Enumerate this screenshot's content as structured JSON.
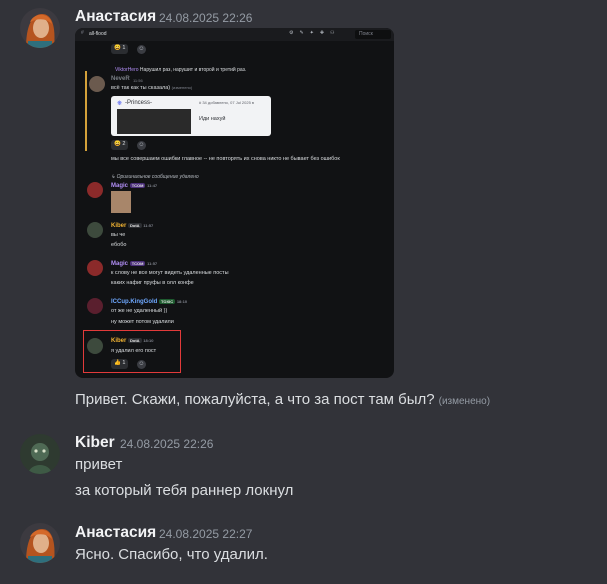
{
  "messages": [
    {
      "author": "Анастасия",
      "timestamp": "24.08.2025 22:26",
      "text": "Привет. Скажи, пожалуйста, а что за пост там был?",
      "edited_label": "(изменено)"
    },
    {
      "author": "Kiber",
      "timestamp": "24.08.2025 22:26",
      "lines": [
        "привет",
        "за который тебя раннер локнул"
      ]
    },
    {
      "author": "Анастасия",
      "timestamp": "24.08.2025 22:27",
      "text": "Ясно. Спасибо, что удалил."
    }
  ],
  "screenshot": {
    "channel": "all-flood",
    "search_placeholder": "Поиск",
    "react1_count": "1",
    "reply_preview_author": "ViktorHero",
    "reply_preview_text": "Нарушил раз, нарушит и второй и третий раз.",
    "m1_author": "NeveR",
    "m1_time": "11:56",
    "m1_text": "всё так как ты сказала)",
    "m1_edited": "(изменено)",
    "invite_title": "-Princess-",
    "invite_meta": "# 34 добавлено, 07 Jul 2025 в",
    "invite_action": "Иди нахуй",
    "react2_count": "2",
    "m2_text": "мы все совершаем ошибки  главное -- не повторять их снова никто не бывает без ошибок",
    "deleted_note": "Оригинальное сообщение удалено",
    "magic_author": "Magic",
    "magic_tag": "TCOM",
    "magic_time1": "11:47",
    "kiber_author": "Kiber",
    "kiber_tag": "DotA",
    "kiber_time1": "11:57",
    "kiber_l1": "вы че",
    "kiber_l2": "ебобо",
    "magic_time2": "11:57",
    "magic_l1": "к слову не все могут видеть удаленные посты",
    "magic_l2": "каких нафиг пруфы в олл конфе",
    "icc_author": "ICCup.KingGold",
    "icc_tag": "TOXIC",
    "icc_time": "18:10",
    "icc_l1": "от же не удаленный ))",
    "icc_l2": "ну может потом удалили",
    "kiber_time2": "18:10",
    "kiber_l3": "я удалил его пост",
    "react3_count": "1"
  },
  "colors": {
    "background": "#323339",
    "username": "#f2f3f5",
    "timestamp": "#949ba4",
    "highlight_box": "#e23a3a"
  }
}
